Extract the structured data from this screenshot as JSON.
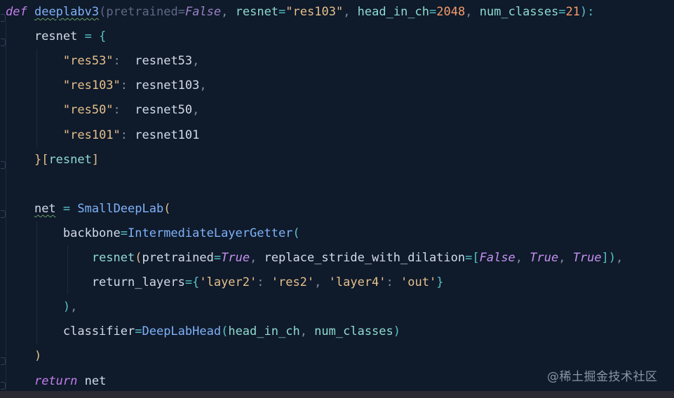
{
  "editor": {
    "lines": [
      [
        {
          "t": "def",
          "c": "kw"
        },
        {
          "t": " ",
          "c": "ident"
        },
        {
          "t": "deeplabv3",
          "c": "fn-u"
        },
        {
          "t": "(",
          "c": "param-dim"
        },
        {
          "t": "pretrained",
          "c": "param-dim"
        },
        {
          "t": "=",
          "c": "param-dim"
        },
        {
          "t": "False",
          "c": "const-dim"
        },
        {
          "t": ", ",
          "c": "comma"
        },
        {
          "t": "resnet",
          "c": "kwarg"
        },
        {
          "t": "=",
          "c": "op"
        },
        {
          "t": "\"res103\"",
          "c": "str"
        },
        {
          "t": ", ",
          "c": "comma"
        },
        {
          "t": "head_in_ch",
          "c": "kwarg"
        },
        {
          "t": "=",
          "c": "op"
        },
        {
          "t": "2048",
          "c": "num"
        },
        {
          "t": ", ",
          "c": "comma"
        },
        {
          "t": "num_classes",
          "c": "kwarg"
        },
        {
          "t": "=",
          "c": "op"
        },
        {
          "t": "21",
          "c": "num"
        },
        {
          "t": "):",
          "c": "punct"
        }
      ],
      [
        {
          "t": "    resnet ",
          "c": "ident"
        },
        {
          "t": "= {",
          "c": "punct"
        }
      ],
      [
        {
          "t": "        ",
          "c": "ident"
        },
        {
          "t": "\"res53\"",
          "c": "str"
        },
        {
          "t": ":  ",
          "c": "comma"
        },
        {
          "t": "resnet53",
          "c": "ident"
        },
        {
          "t": ",",
          "c": "comma"
        }
      ],
      [
        {
          "t": "        ",
          "c": "ident"
        },
        {
          "t": "\"res103\"",
          "c": "str"
        },
        {
          "t": ": ",
          "c": "comma"
        },
        {
          "t": "resnet103",
          "c": "ident"
        },
        {
          "t": ",",
          "c": "comma"
        }
      ],
      [
        {
          "t": "        ",
          "c": "ident"
        },
        {
          "t": "\"res50\"",
          "c": "str"
        },
        {
          "t": ":  ",
          "c": "comma"
        },
        {
          "t": "resnet50",
          "c": "ident"
        },
        {
          "t": ",",
          "c": "comma"
        }
      ],
      [
        {
          "t": "        ",
          "c": "ident"
        },
        {
          "t": "\"res101\"",
          "c": "str"
        },
        {
          "t": ": ",
          "c": "comma"
        },
        {
          "t": "resnet101",
          "c": "ident"
        }
      ],
      [
        {
          "t": "    ",
          "c": "ident"
        },
        {
          "t": "}[",
          "c": "str"
        },
        {
          "t": "resnet",
          "c": "kwarg"
        },
        {
          "t": "]",
          "c": "str"
        }
      ],
      [],
      [
        {
          "t": "    ",
          "c": "ident"
        },
        {
          "t": "net",
          "c": "ident-u"
        },
        {
          "t": " = ",
          "c": "op"
        },
        {
          "t": "SmallDeepLab",
          "c": "cls"
        },
        {
          "t": "(",
          "c": "str"
        }
      ],
      [
        {
          "t": "        backbone",
          "c": "ident"
        },
        {
          "t": "=",
          "c": "op"
        },
        {
          "t": "IntermediateLayerGetter",
          "c": "cls"
        },
        {
          "t": "(",
          "c": "punct"
        }
      ],
      [
        {
          "t": "            ",
          "c": "ident"
        },
        {
          "t": "resnet",
          "c": "kwarg"
        },
        {
          "t": "(",
          "c": "str"
        },
        {
          "t": "pretrained",
          "c": "ident"
        },
        {
          "t": "=",
          "c": "op"
        },
        {
          "t": "True",
          "c": "const"
        },
        {
          "t": ", ",
          "c": "comma"
        },
        {
          "t": "replace_stride_with_dilation",
          "c": "ident"
        },
        {
          "t": "=[",
          "c": "op"
        },
        {
          "t": "False",
          "c": "const"
        },
        {
          "t": ", ",
          "c": "comma"
        },
        {
          "t": "True",
          "c": "const"
        },
        {
          "t": ", ",
          "c": "comma"
        },
        {
          "t": "True",
          "c": "const"
        },
        {
          "t": "])",
          "c": "punct"
        },
        {
          "t": ",",
          "c": "comma"
        }
      ],
      [
        {
          "t": "            return_layers",
          "c": "ident"
        },
        {
          "t": "={",
          "c": "op"
        },
        {
          "t": "'layer2'",
          "c": "str"
        },
        {
          "t": ": ",
          "c": "comma"
        },
        {
          "t": "'res2'",
          "c": "str"
        },
        {
          "t": ", ",
          "c": "comma"
        },
        {
          "t": "'layer4'",
          "c": "str"
        },
        {
          "t": ": ",
          "c": "comma"
        },
        {
          "t": "'out'",
          "c": "str"
        },
        {
          "t": "}",
          "c": "op"
        }
      ],
      [
        {
          "t": "        ",
          "c": "ident"
        },
        {
          "t": ")",
          "c": "punct"
        },
        {
          "t": ",",
          "c": "comma"
        }
      ],
      [
        {
          "t": "        classifier",
          "c": "ident"
        },
        {
          "t": "=",
          "c": "op"
        },
        {
          "t": "DeepLabHead",
          "c": "cls"
        },
        {
          "t": "(",
          "c": "punct"
        },
        {
          "t": "head_in_ch",
          "c": "kwarg"
        },
        {
          "t": ", ",
          "c": "comma"
        },
        {
          "t": "num_classes",
          "c": "kwarg"
        },
        {
          "t": ")",
          "c": "punct"
        }
      ],
      [
        {
          "t": "    ",
          "c": "ident"
        },
        {
          "t": ")",
          "c": "str"
        }
      ],
      [
        {
          "t": "    ",
          "c": "ident"
        },
        {
          "t": "return",
          "c": "kw"
        },
        {
          "t": " net",
          "c": "ident"
        }
      ]
    ]
  },
  "watermark": {
    "text": "@稀土掘金技术社区"
  }
}
